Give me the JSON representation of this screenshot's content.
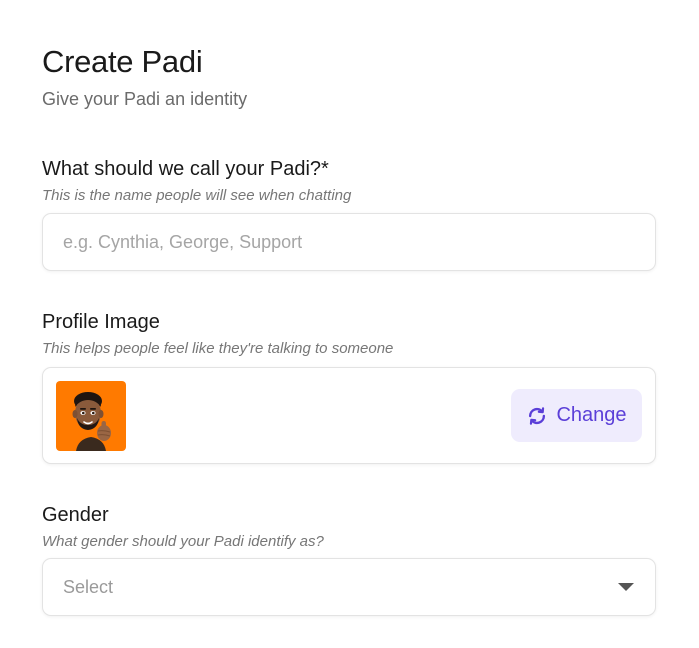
{
  "header": {
    "title": "Create Padi",
    "subtitle": "Give your Padi an identity"
  },
  "name_field": {
    "label": "What should we call your Padi?*",
    "help": "This is the name people will see when chatting",
    "placeholder": "e.g. Cynthia, George, Support",
    "value": ""
  },
  "profile_image": {
    "label": "Profile Image",
    "help": "This helps people feel like they're talking to someone",
    "avatar_bg": "#ff7a00",
    "change_label": "Change",
    "change_icon": "refresh-icon",
    "accent": "#5b3fd8"
  },
  "gender": {
    "label": "Gender",
    "help": "What gender should your Padi identify as?",
    "selected": "Select",
    "icon": "caret-down-icon"
  }
}
